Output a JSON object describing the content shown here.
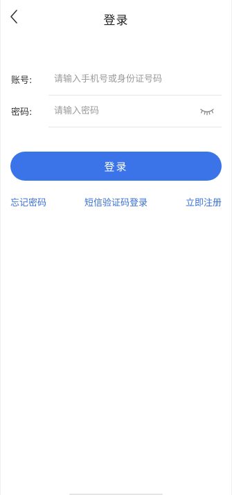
{
  "header": {
    "title": "登录",
    "back_icon": "chevron-left-icon"
  },
  "form": {
    "account": {
      "label": "账号:",
      "placeholder": "请输入手机号或身份证号码",
      "value": ""
    },
    "password": {
      "label": "密码:",
      "placeholder": "请输入密码",
      "value": "",
      "toggle_icon": "eye-closed-icon"
    }
  },
  "actions": {
    "login_label": "登录",
    "forgot_password": "忘记密码",
    "sms_login": "短信验证码登录",
    "register": "立即注册"
  },
  "colors": {
    "primary": "#3b74e8",
    "link": "#3b6fd4",
    "divider": "#e6e6e6",
    "placeholder": "#9a9a9a"
  }
}
